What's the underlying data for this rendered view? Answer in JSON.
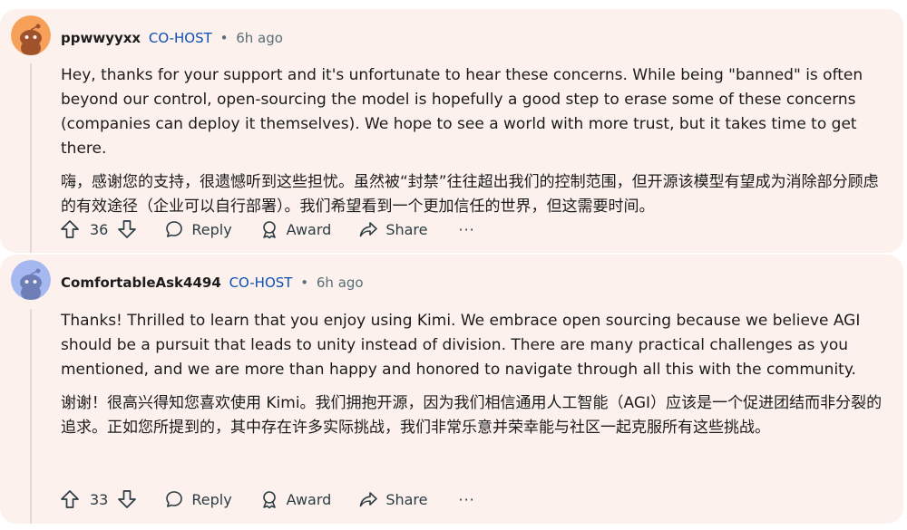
{
  "comments": [
    {
      "username": "ppwwyyxx",
      "role": "CO-HOST",
      "separator": "•",
      "time": "6h ago",
      "text_en": "Hey, thanks for your support and it's unfortunate to hear these concerns. While being \"banned\" is often beyond our control, open-sourcing the model is hopefully a good step to erase some of these concerns (companies can deploy it themselves). We hope to see a world with more trust, but it takes time to get there.",
      "text_zh": "嗨，感谢您的支持，很遗憾听到这些担忧。虽然被“封禁”往往超出我们的控制范围，但开源该模型有望成为消除部分顾虑的有效途径（企业可以自行部署）。我们希望看到一个更加信任的世界，但这需要时间。",
      "votes": "36",
      "reply_label": "Reply",
      "award_label": "Award",
      "share_label": "Share",
      "more_label": "···",
      "avatar_color": "#f6a05a"
    },
    {
      "username": "ComfortableAsk4494",
      "role": "CO-HOST",
      "separator": "•",
      "time": "6h ago",
      "text_en": "Thanks! Thrilled to learn that you enjoy using Kimi. We embrace open sourcing because we believe AGI should be a pursuit that leads to unity instead of division. There are many practical challenges as you mentioned, and we are more than happy and honored to navigate through all this with the community.",
      "text_zh": "谢谢！很高兴得知您喜欢使用 Kimi。我们拥抱开源，因为我们相信通用人工智能（AGI）应该是一个促进团结而非分裂的追求。正如您所提到的，其中存在许多实际挑战，我们非常乐意并荣幸能与社区一起克服所有这些挑战。",
      "votes": "33",
      "reply_label": "Reply",
      "award_label": "Award",
      "share_label": "Share",
      "more_label": "···",
      "avatar_color": "#a6b8f0"
    }
  ],
  "colors": {
    "card_bg": "#fdf1ee",
    "role": "#0a4fb5",
    "meta": "#576f76",
    "action": "#2a3c42"
  }
}
